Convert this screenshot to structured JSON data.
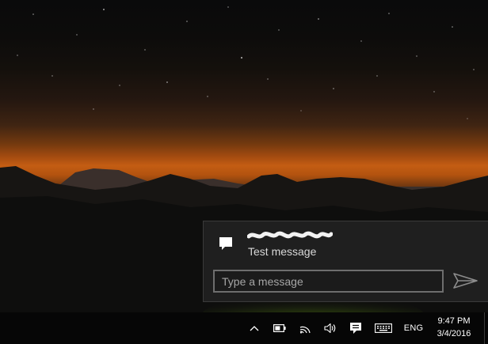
{
  "notification": {
    "icon": "message-icon",
    "sender": "",
    "message": "Test message",
    "reply_placeholder": "Type a message",
    "send_icon": "send-icon"
  },
  "taskbar": {
    "tray_icons": [
      "chevron-up-icon",
      "battery-icon",
      "wifi-icon",
      "volume-icon",
      "action-center-icon",
      "keyboard-icon"
    ],
    "language": "ENG",
    "clock": {
      "time": "9:47 PM",
      "date": "3/4/2016"
    }
  },
  "colors": {
    "toast_background": "#1f1f1f",
    "taskbar_background": "#060606",
    "sky_glow": "#c45d13",
    "grass_glow": "#8fd11a"
  }
}
